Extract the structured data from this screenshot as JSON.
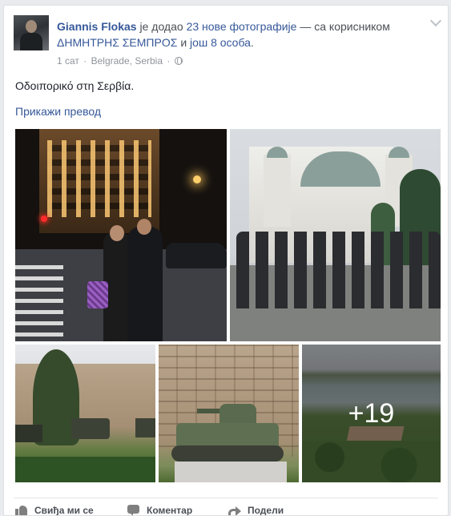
{
  "post": {
    "author": "Giannis Flokas",
    "action_text": "је додао",
    "photos_link": "23 нове фотографије",
    "with_text": "— са корисником",
    "tagged_user": "ΔΗΜΗΤΡΗΣ ΣΕΜΠΡΟΣ",
    "and_text": "и",
    "others_link": "још 8 особа",
    "period": ".",
    "time": "1 сат",
    "location": "Belgrade, Serbia",
    "dot": "·",
    "privacy_icon": "globe-icon",
    "text": "Οδοιπορικό στη Σερβία.",
    "translate_link": "Прикажи превод",
    "more_photos": "+19"
  },
  "actions": {
    "like": "Свиђа ми се",
    "comment": "Коментар",
    "share": "Подели"
  },
  "colors": {
    "link": "#365899",
    "text": "#1d2129",
    "meta": "#90949c",
    "background": "#e9ebee"
  }
}
